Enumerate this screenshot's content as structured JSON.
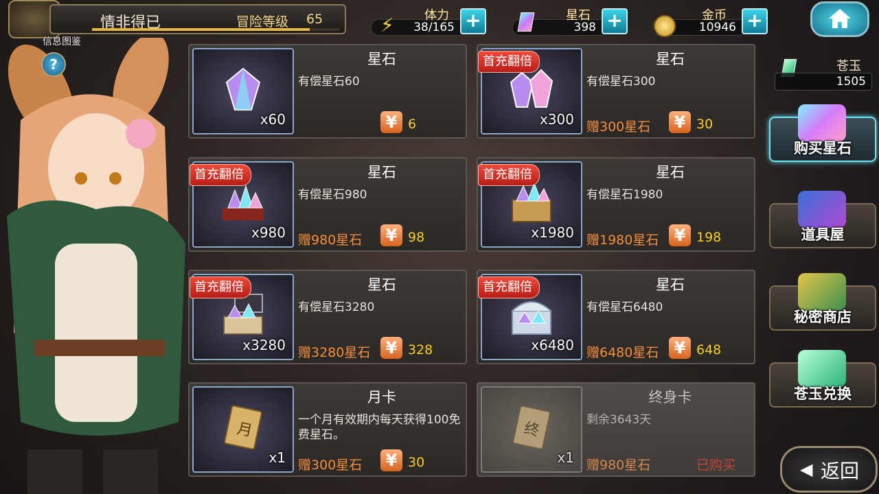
{
  "header": {
    "player_name": "情非得已",
    "rank_label": "冒险等级",
    "rank_value": "65",
    "xp_fraction": 0.88,
    "info_label": "信息图鉴",
    "help_symbol": "?"
  },
  "resources": [
    {
      "label": "体力",
      "value": "38/165",
      "icon": "lightning-icon"
    },
    {
      "label": "星石",
      "value": "398",
      "icon": "star-stone-icon"
    },
    {
      "label": "金币",
      "value": "10946",
      "icon": "gold-coin-icon"
    }
  ],
  "plus_symbol": "+",
  "jade": {
    "label": "苍玉",
    "value": "1505"
  },
  "side_menu": [
    {
      "label": "购买星石",
      "active": true
    },
    {
      "label": "道具屋",
      "active": false
    },
    {
      "label": "秘密商店",
      "active": false
    },
    {
      "label": "苍玉兑换",
      "active": false
    }
  ],
  "back": {
    "arrow": "◀",
    "label": "返回"
  },
  "currency_symbol": "¥",
  "cards": [
    {
      "title": "星石",
      "desc": "有偿星石60",
      "qty": "x60",
      "badge": "",
      "bonus": "",
      "price": "6",
      "status": ""
    },
    {
      "title": "星石",
      "desc": "有偿星石300",
      "qty": "x300",
      "badge": "首充翻倍",
      "bonus": "赠300星石",
      "price": "30",
      "status": ""
    },
    {
      "title": "星石",
      "desc": "有偿星石980",
      "qty": "x980",
      "badge": "首充翻倍",
      "bonus": "赠980星石",
      "price": "98",
      "status": ""
    },
    {
      "title": "星石",
      "desc": "有偿星石1980",
      "qty": "x1980",
      "badge": "首充翻倍",
      "bonus": "赠1980星石",
      "price": "198",
      "status": ""
    },
    {
      "title": "星石",
      "desc": "有偿星石3280",
      "qty": "x3280",
      "badge": "首充翻倍",
      "bonus": "赠3280星石",
      "price": "328",
      "status": ""
    },
    {
      "title": "星石",
      "desc": "有偿星石6480",
      "qty": "x6480",
      "badge": "首充翻倍",
      "bonus": "赠6480星石",
      "price": "648",
      "status": ""
    },
    {
      "title": "月卡",
      "desc": "一个月有效期内每天获得100免费星石。",
      "qty": "x1",
      "badge": "",
      "bonus": "赠300星石",
      "price": "30",
      "status": ""
    },
    {
      "title": "终身卡",
      "desc": "剩余3643天",
      "qty": "x1",
      "badge": "",
      "bonus": "赠980星石",
      "price": "",
      "status": "已购买"
    }
  ]
}
